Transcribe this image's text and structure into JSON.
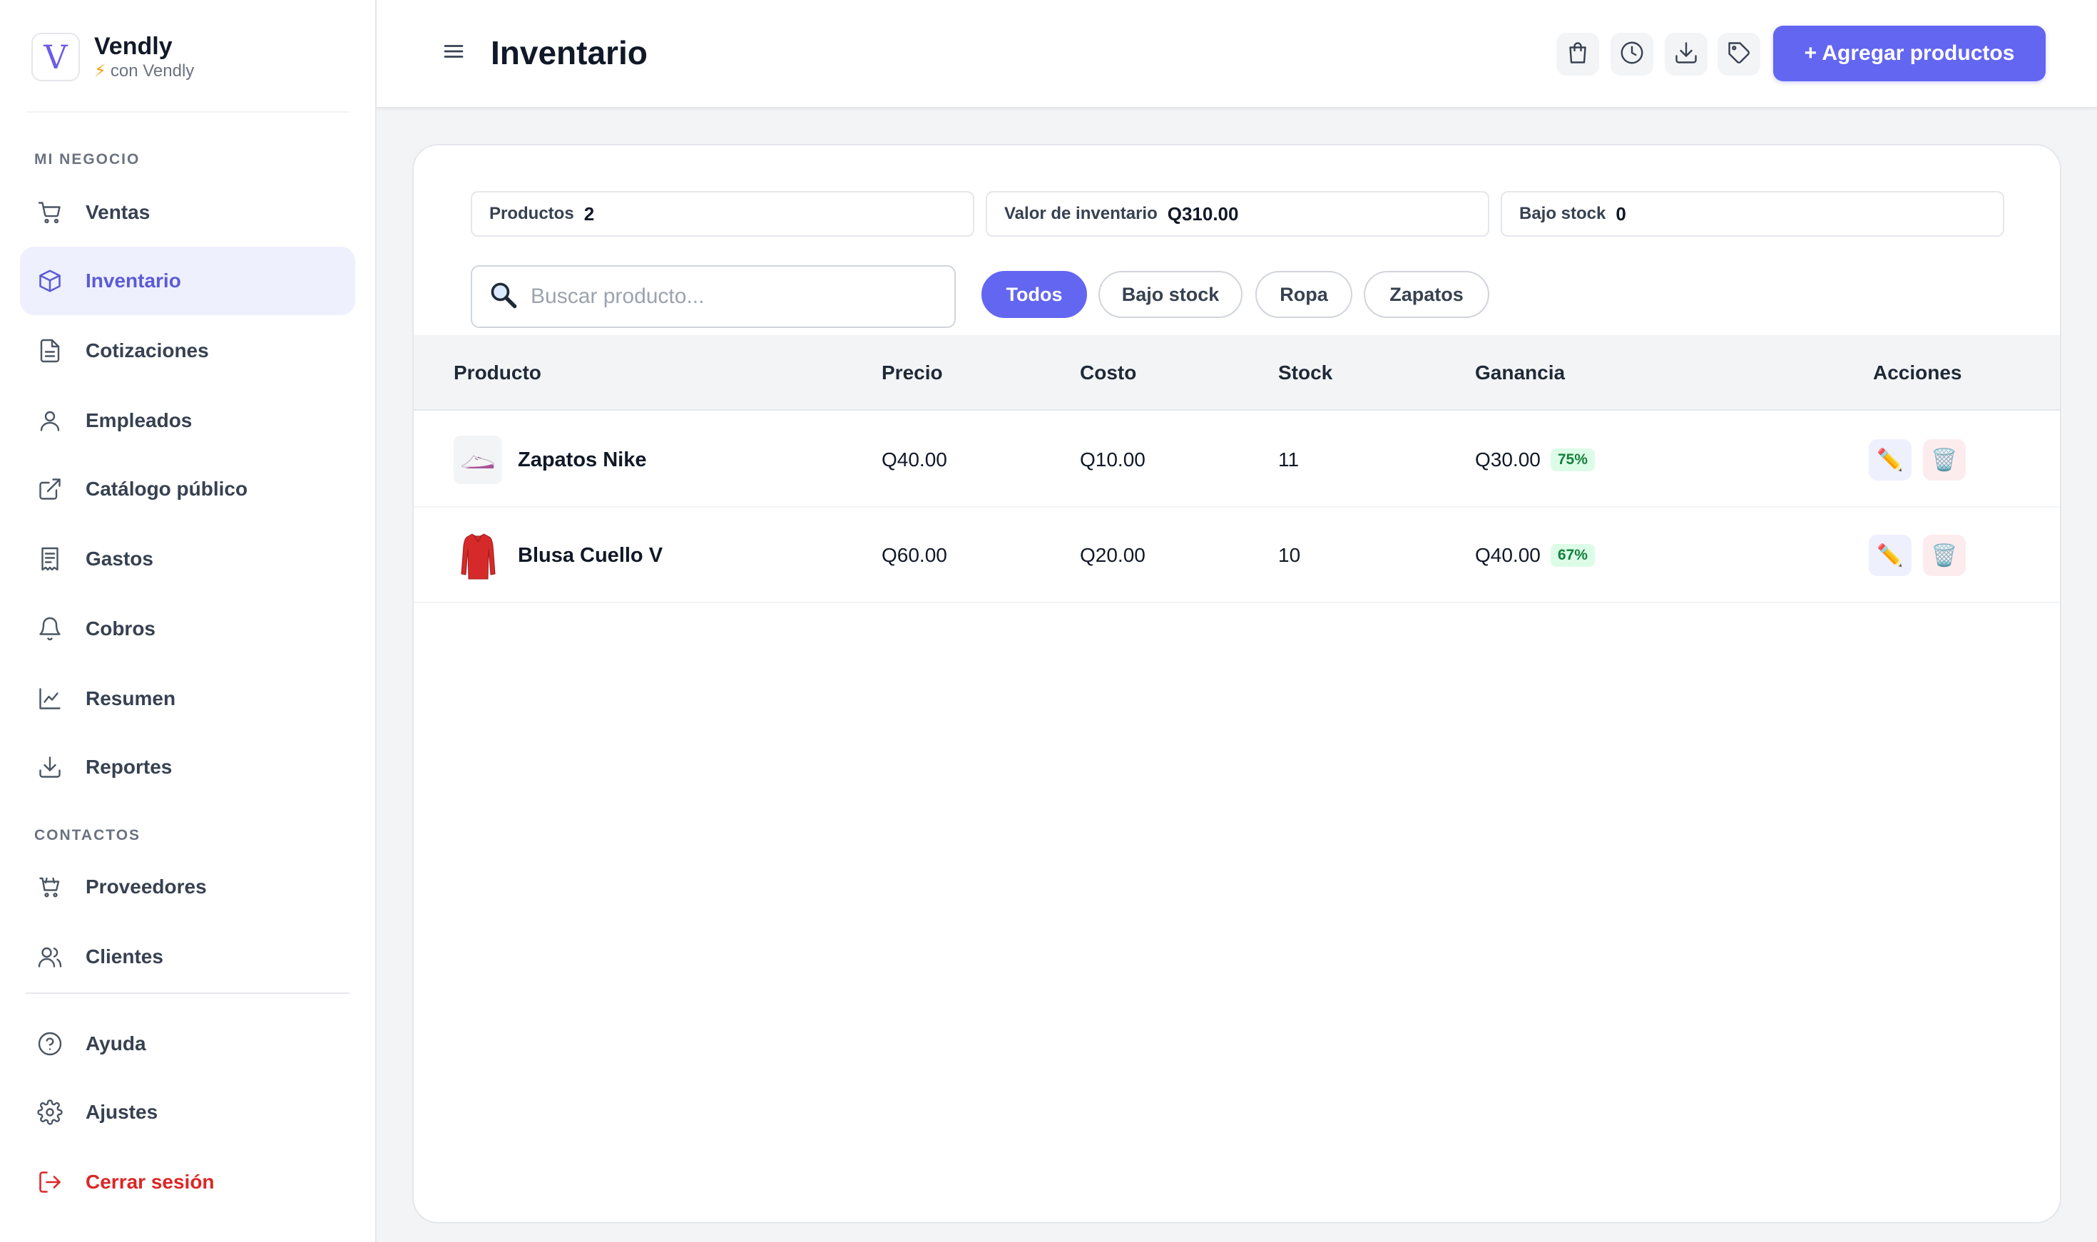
{
  "brand": {
    "logo_letter": "V",
    "name": "Vendly",
    "sub": "con Vendly"
  },
  "sidebar": {
    "section_business": "MI NEGOCIO",
    "section_contacts": "CONTACTOS",
    "items": [
      {
        "label": "Ventas",
        "icon": "cart-icon"
      },
      {
        "label": "Inventario",
        "icon": "box-icon",
        "active": true
      },
      {
        "label": "Cotizaciones",
        "icon": "document-icon"
      },
      {
        "label": "Empleados",
        "icon": "user-icon"
      },
      {
        "label": "Catálogo público",
        "icon": "external-link-icon"
      },
      {
        "label": "Gastos",
        "icon": "receipt-icon"
      },
      {
        "label": "Cobros",
        "icon": "bell-icon"
      },
      {
        "label": "Resumen",
        "icon": "chart-line-icon"
      },
      {
        "label": "Reportes",
        "icon": "download-icon"
      }
    ],
    "contacts": [
      {
        "label": "Proveedores",
        "icon": "basket-icon"
      },
      {
        "label": "Clientes",
        "icon": "users-icon"
      }
    ],
    "footer": [
      {
        "label": "Ayuda",
        "icon": "help-icon"
      },
      {
        "label": "Ajustes",
        "icon": "gear-icon"
      },
      {
        "label": "Cerrar sesión",
        "icon": "logout-icon"
      }
    ]
  },
  "header": {
    "title": "Inventario",
    "add_button": "+ Agregar productos",
    "icons": [
      "shopping-bag-icon",
      "clock-icon",
      "download-icon",
      "tag-icon"
    ]
  },
  "stats": {
    "products_label": "Productos",
    "products_value": "2",
    "inventory_label": "Valor de inventario",
    "inventory_value": "Q310.00",
    "lowstock_label": "Bajo stock",
    "lowstock_value": "0"
  },
  "search": {
    "placeholder": "Buscar producto...",
    "value": ""
  },
  "filters": [
    {
      "label": "Todos",
      "active": true
    },
    {
      "label": "Bajo stock"
    },
    {
      "label": "Ropa"
    },
    {
      "label": "Zapatos"
    }
  ],
  "table": {
    "columns": [
      "Producto",
      "Precio",
      "Costo",
      "Stock",
      "Ganancia",
      "Acciones"
    ],
    "rows": [
      {
        "name": "Zapatos Nike",
        "price": "Q40.00",
        "cost": "Q10.00",
        "stock": "11",
        "profit": "Q30.00",
        "margin": "75%"
      },
      {
        "name": "Blusa Cuello V",
        "price": "Q60.00",
        "cost": "Q20.00",
        "stock": "10",
        "profit": "Q40.00",
        "margin": "67%"
      }
    ]
  },
  "colors": {
    "accent": "#6366f1",
    "danger": "#dc2626",
    "success": "#15803d"
  }
}
